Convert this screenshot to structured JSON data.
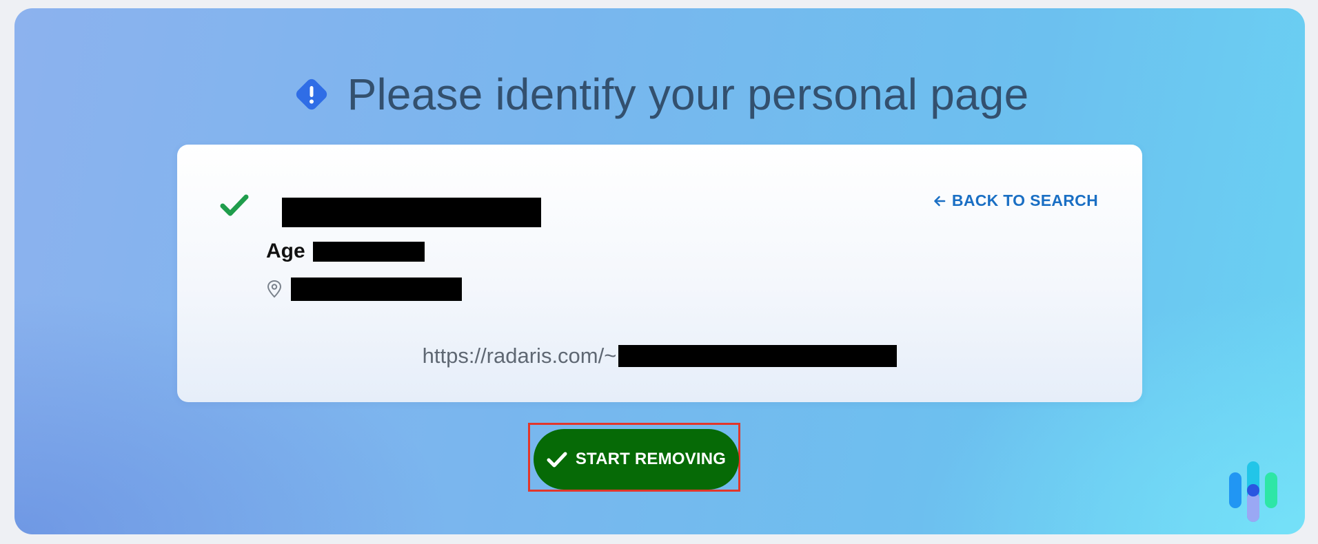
{
  "header": {
    "title": "Please identify your personal page",
    "icon": "alert-diamond-icon",
    "icon_color": "#2563eb"
  },
  "profile_card": {
    "back_link_label": "BACK TO SEARCH",
    "age_label": "Age",
    "url_prefix": "https://radaris.com/~",
    "check_color": "#16a34a",
    "link_color": "#1a6fc4"
  },
  "action": {
    "button_label": "START REMOVING",
    "button_color": "#066a06",
    "highlight_color": "#e2362b"
  },
  "brand": {
    "logo_icon": "bars-logo-icon"
  }
}
